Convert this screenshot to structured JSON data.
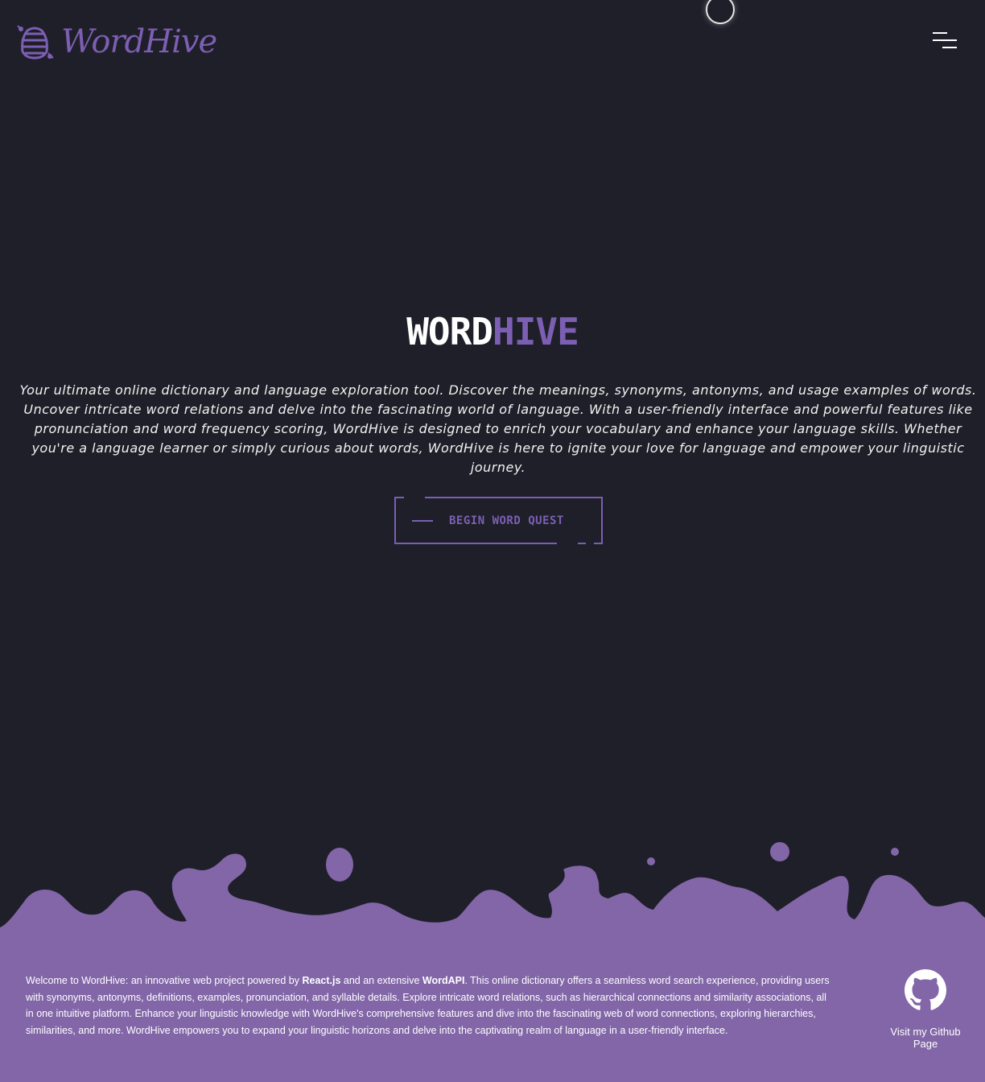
{
  "header": {
    "logo_text": "WordHive",
    "logo_icon": "bee-hive-icon",
    "menu_icon": "hamburger-menu-icon"
  },
  "hero": {
    "title_part1": "WORD",
    "title_part2": "HIVE",
    "description": "Your ultimate online dictionary and language exploration tool. Discover the meanings, synonyms, antonyms, and usage examples of words. Uncover intricate word relations and delve into the fascinating world of language. With a user-friendly interface and powerful features like pronunciation and word frequency scoring, WordHive is designed to enrich your vocabulary and enhance your language skills. Whether you're a language learner or simply curious about words, WordHive is here to ignite your love for language and empower your linguistic journey.",
    "cta_label": "BEGIN WORD QUEST"
  },
  "footer": {
    "text_intro": "Welcome to WordHive: an innovative web project powered by ",
    "tech1": "React.js",
    "text_and": " and an extensive ",
    "tech2": "WordAPI",
    "text_rest": ". This online dictionary offers a seamless word search experience, providing users with synonyms, antonyms, definitions, examples, pronunciation, and syllable details. Explore intricate word relations, such as hierarchical connections and similarity associations, all in one intuitive platform. Enhance your linguistic knowledge with WordHive's comprehensive features and dive into the fascinating web of word connections, exploring hierarchies, similarities, and more. WordHive empowers you to expand your linguistic horizons and delve into the captivating realm of language in a user-friendly interface.",
    "github_label": "Visit my Github Page",
    "github_icon": "github-icon"
  },
  "colors": {
    "background": "#1f1f29",
    "accent": "#7c5fb3",
    "footer": "#8266a8",
    "text": "#ffffff"
  }
}
